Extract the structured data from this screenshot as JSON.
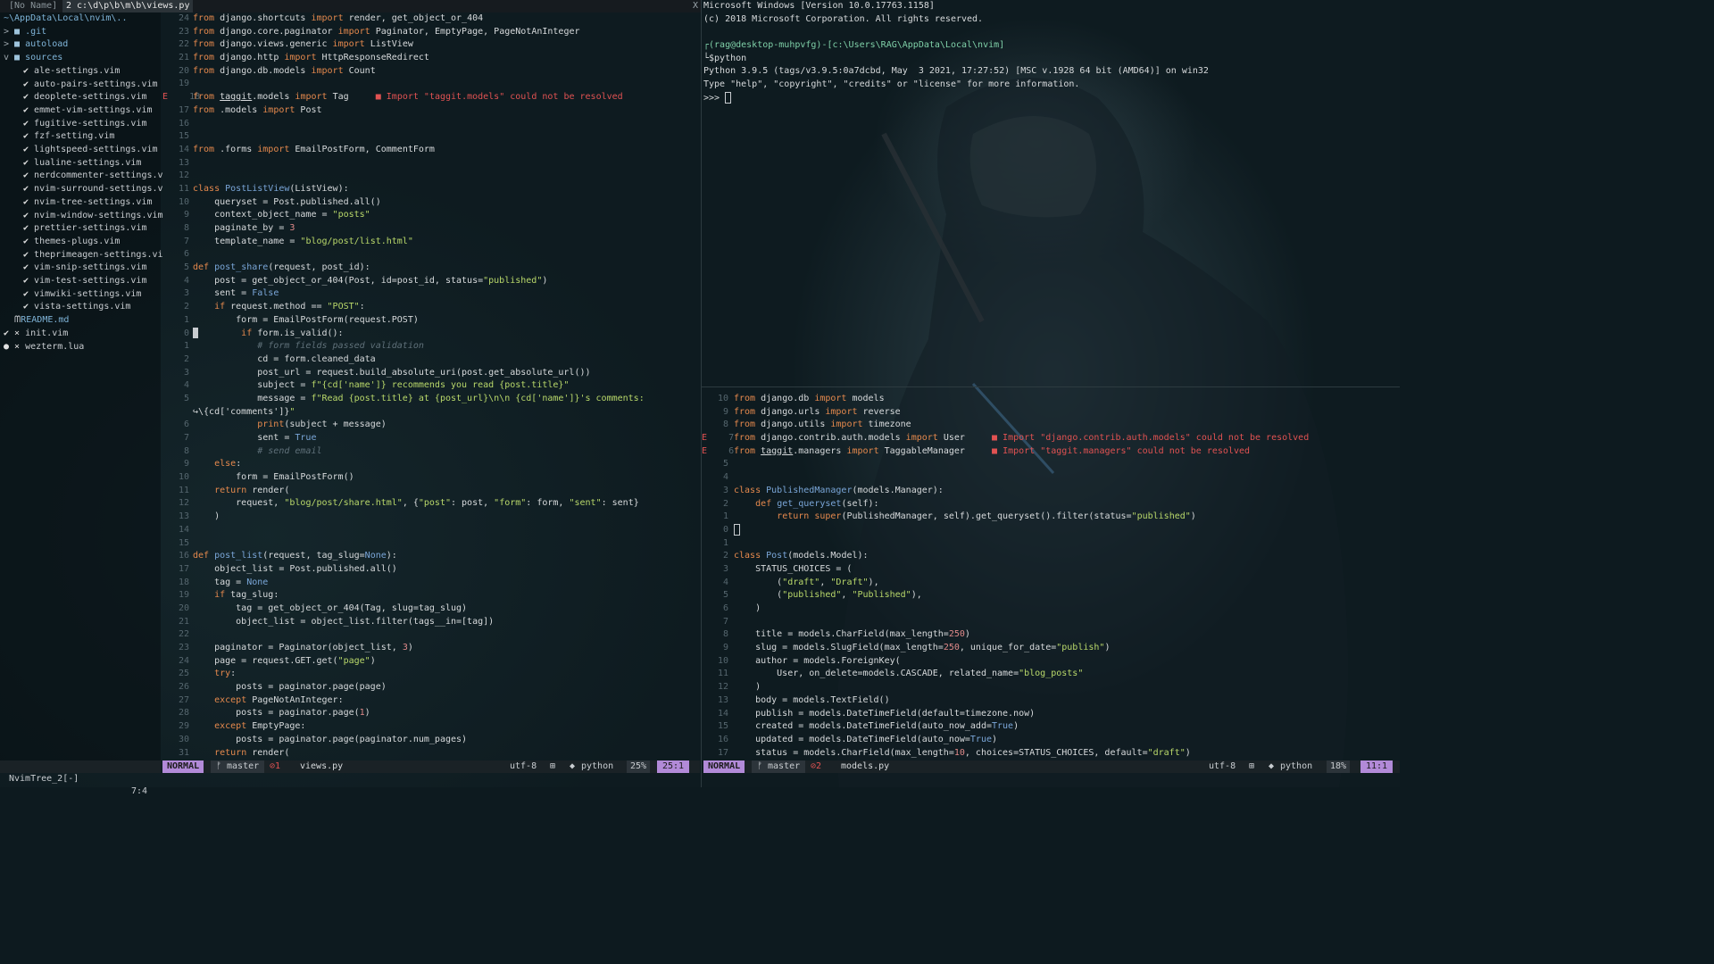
{
  "tabline": {
    "inactive_tab": "[No Name]",
    "active_tab": "2 c:\\d\\p\\b\\m\\b\\views.py",
    "close": "X"
  },
  "tree": {
    "root": "~\\AppData\\Local\\nvim\\..",
    "items": [
      {
        "mark": ">",
        "icon": "folder-icon",
        "label": ".git",
        "kind": "folder"
      },
      {
        "mark": ">",
        "icon": "folder-icon",
        "label": "autoload",
        "kind": "folder"
      },
      {
        "mark": "v",
        "icon": "folder-open-icon",
        "label": "sources",
        "kind": "folder"
      },
      {
        "mark": "✔",
        "label": "ale-settings.vim",
        "kind": "file"
      },
      {
        "mark": "✔",
        "label": "auto-pairs-settings.vim",
        "kind": "file"
      },
      {
        "mark": "✔",
        "label": "deoplete-settings.vim",
        "kind": "file"
      },
      {
        "mark": "✔",
        "label": "emmet-vim-settings.vim",
        "kind": "file"
      },
      {
        "mark": "✔",
        "label": "fugitive-settings.vim",
        "kind": "file"
      },
      {
        "mark": "✔",
        "label": "fzf-setting.vim",
        "kind": "file"
      },
      {
        "mark": "✔",
        "label": "lightspeed-settings.vim",
        "kind": "file"
      },
      {
        "mark": "✔",
        "label": "lualine-settings.vim",
        "kind": "file"
      },
      {
        "mark": "✔",
        "label": "nerdcommenter-settings.v",
        "kind": "file"
      },
      {
        "mark": "✔",
        "label": "nvim-surround-settings.v",
        "kind": "file"
      },
      {
        "mark": "✔",
        "label": "nvim-tree-settings.vim",
        "kind": "file"
      },
      {
        "mark": "✔",
        "label": "nvim-window-settings.vim",
        "kind": "file"
      },
      {
        "mark": "✔",
        "label": "prettier-settings.vim",
        "kind": "file"
      },
      {
        "mark": "✔",
        "label": "themes-plugs.vim",
        "kind": "file"
      },
      {
        "mark": "✔",
        "label": "theprimeagen-settings.vi",
        "kind": "file"
      },
      {
        "mark": "✔",
        "label": "vim-snip-settings.vim",
        "kind": "file"
      },
      {
        "mark": "✔",
        "label": "vim-test-settings.vim",
        "kind": "file"
      },
      {
        "mark": "✔",
        "label": "vimwiki-settings.vim",
        "kind": "file"
      },
      {
        "mark": "✔",
        "label": "vista-settings.vim",
        "kind": "file"
      },
      {
        "mark": "",
        "label": "README.md",
        "kind": "readme"
      },
      {
        "mark": "✔ ×",
        "label": "init.vim",
        "kind": "file"
      },
      {
        "mark": "● ×",
        "label": "wezterm.lua",
        "kind": "file"
      }
    ]
  },
  "left_editor": {
    "gutter": [
      "24",
      "23",
      "22",
      "21",
      "20",
      "19",
      "E 18",
      "17",
      "16",
      "15",
      "14",
      "13",
      "12",
      "11",
      "10",
      "9",
      "8",
      "7",
      "6",
      "5",
      "4",
      "3",
      "2",
      "1",
      "0",
      "1",
      "2",
      "3",
      "4",
      "5",
      "",
      "6",
      "7",
      "8",
      "9",
      "10",
      "11",
      "12",
      "13",
      "14",
      "15",
      "16",
      "17",
      "18",
      "19",
      "20",
      "21",
      "22",
      "23",
      "24",
      "25",
      "26",
      "27",
      "28",
      "29",
      "30",
      "31"
    ],
    "lines": [
      "from django.shortcuts import render, get_object_or_404",
      "from django.core.paginator import Paginator, EmptyPage, PageNotAnInteger",
      "from django.views.generic import ListView",
      "from django.http import HttpResponseRedirect",
      "from django.db.models import Count",
      "",
      "from taggit.models import Tag     ■ Import \"taggit.models\" could not be resolved",
      "from .models import Post",
      "",
      "",
      "from .forms import EmailPostForm, CommentForm",
      "",
      "",
      "class PostListView(ListView):",
      "    queryset = Post.published.all()",
      "    context_object_name = \"posts\"",
      "    paginate_by = 3",
      "    template_name = \"blog/post/list.html\"",
      "",
      "def post_share(request, post_id):",
      "    post = get_object_or_404(Post, id=post_id, status=\"published\")",
      "    sent = False",
      "    if request.method == \"POST\":",
      "        form = EmailPostForm(request.POST)",
      "        if form.is_valid():",
      "            # form fields passed validation",
      "            cd = form.cleaned_data",
      "            post_url = request.build_absolute_uri(post.get_absolute_url())",
      "            subject = f\"{cd['name']} recommends you read {post.title}\"",
      "            message = f\"Read {post.title} at {post_url}\\n\\n {cd['name']}'s comments:",
      "↪\\{cd['comments']}\"",
      "            print(subject + message)",
      "            sent = True",
      "            # send email",
      "    else:",
      "        form = EmailPostForm()",
      "    return render(",
      "        request, \"blog/post/share.html\", {\"post\": post, \"form\": form, \"sent\": sent}",
      "    )",
      "",
      "",
      "def post_list(request, tag_slug=None):",
      "    object_list = Post.published.all()",
      "    tag = None",
      "    if tag_slug:",
      "        tag = get_object_or_404(Tag, slug=tag_slug)",
      "        object_list = object_list.filter(tags__in=[tag])",
      "",
      "    paginator = Paginator(object_list, 3)",
      "    page = request.GET.get(\"page\")",
      "    try:",
      "        posts = paginator.page(page)",
      "    except PageNotAnInteger:",
      "        posts = paginator.page(1)",
      "    except EmptyPage:",
      "        posts = paginator.page(paginator.num_pages)",
      "    return render("
    ]
  },
  "terminal": {
    "lines": [
      "Microsoft Windows [Version 10.0.17763.1158]",
      "(c) 2018 Microsoft Corporation. All rights reserved.",
      "",
      "┌(rag@desktop-muhpvfg)-[c:\\Users\\RAG\\AppData\\Local\\nvim]",
      "└$python",
      "Python 3.9.5 (tags/v3.9.5:0a7dcbd, May  3 2021, 17:27:52) [MSC v.1928 64 bit (AMD64)] on win32",
      "Type \"help\", \"copyright\", \"credits\" or \"license\" for more information.",
      ">>> "
    ]
  },
  "right_editor": {
    "gutter": [
      "10",
      "9",
      "8",
      "E 7",
      "E 6",
      "5",
      "4",
      "3",
      "2",
      "1",
      "0",
      "1",
      "2",
      "3",
      "4",
      "5",
      "6",
      "7",
      "8",
      "9",
      "10",
      "11",
      "12",
      "13",
      "14",
      "15",
      "16",
      "17"
    ],
    "lines": [
      "from django.db import models",
      "from django.urls import reverse",
      "from django.utils import timezone",
      "from django.contrib.auth.models import User     ■ Import \"django.contrib.auth.models\" could not be resolved",
      "from taggit.managers import TaggableManager     ■ Import \"taggit.managers\" could not be resolved",
      "",
      "",
      "class PublishedManager(models.Manager):",
      "    def get_queryset(self):",
      "        return super(PublishedManager, self).get_queryset().filter(status=\"published\")",
      "",
      "",
      "class Post(models.Model):",
      "    STATUS_CHOICES = (",
      "        (\"draft\", \"Draft\"),",
      "        (\"published\", \"Published\"),",
      "    )",
      "",
      "    title = models.CharField(max_length=250)",
      "    slug = models.SlugField(max_length=250, unique_for_date=\"publish\")",
      "    author = models.ForeignKey(",
      "        User, on_delete=models.CASCADE, related_name=\"blog_posts\"",
      "    )",
      "    body = models.TextField()",
      "    publish = models.DateTimeField(default=timezone.now)",
      "    created = models.DateTimeField(auto_now_add=True)",
      "    updated = models.DateTimeField(auto_now=True)",
      "    status = models.CharField(max_length=10, choices=STATUS_CHOICES, default=\"draft\")"
    ]
  },
  "status_tree": {
    "name": "NvimTree_2[-]",
    "pos": "7:4"
  },
  "status_left": {
    "mode": "NORMAL",
    "branch": "ᚠ master",
    "diag": "⊘1",
    "file": "views.py",
    "encoding": "utf-8",
    "os_icon": "⊞",
    "filetype": "python",
    "percent": "25%",
    "position": "25:1"
  },
  "status_right": {
    "mode": "NORMAL",
    "branch": "ᚠ master",
    "diag": "⊘2",
    "file": "models.py",
    "encoding": "utf-8",
    "os_icon": "⊞",
    "filetype": "python",
    "percent": "18%",
    "position": "11:1"
  },
  "colors": {
    "mode_bg": "#b28ad8",
    "keyword": "#e5894d",
    "string": "#b9d86a",
    "function": "#7aa6d8",
    "error": "#e05252"
  }
}
